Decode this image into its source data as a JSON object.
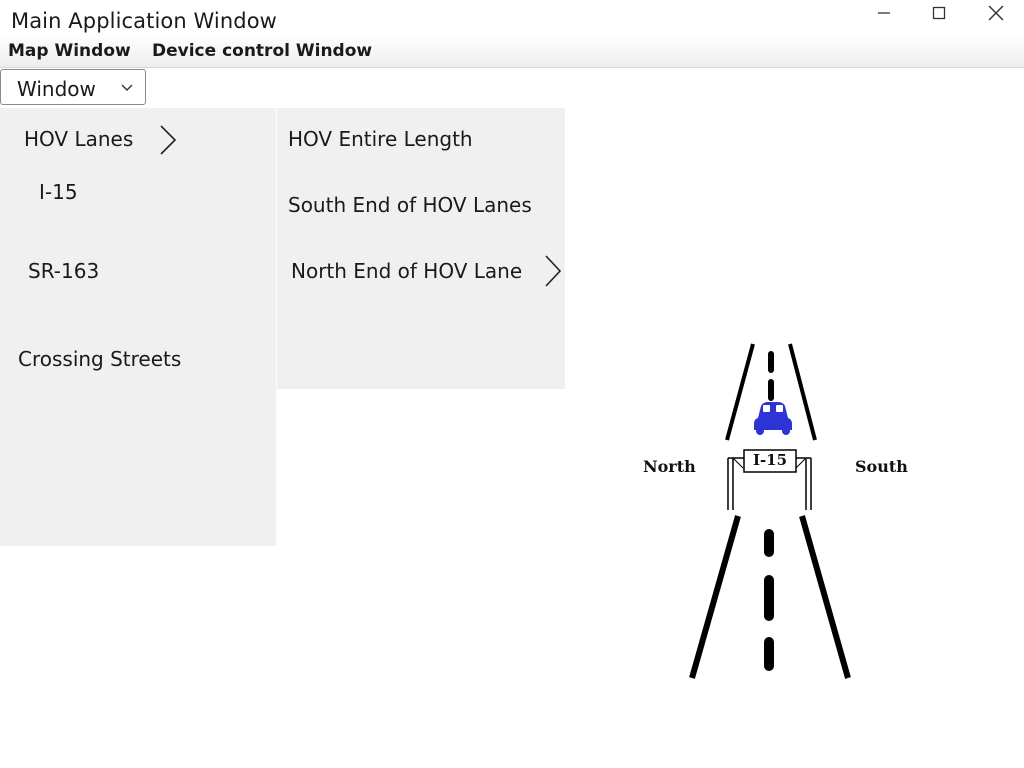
{
  "window": {
    "title": "Main Application Window",
    "controls": [
      "minimize-icon",
      "maximize-icon",
      "close-icon"
    ]
  },
  "menubar": {
    "items": [
      "Map Window",
      "Device control Window"
    ]
  },
  "window_select": {
    "value": "Window"
  },
  "menu_level1": {
    "items": [
      "HOV Lanes",
      "I-15",
      "SR-163",
      "Crossing Streets"
    ]
  },
  "menu_level2": {
    "items": [
      "HOV Entire Length",
      "South End of HOV Lanes",
      "North End of HOV Lane"
    ]
  },
  "illustration": {
    "sign_text": "I-15",
    "left_label": "North",
    "right_label": "South",
    "car_color": "#2d33d6"
  }
}
